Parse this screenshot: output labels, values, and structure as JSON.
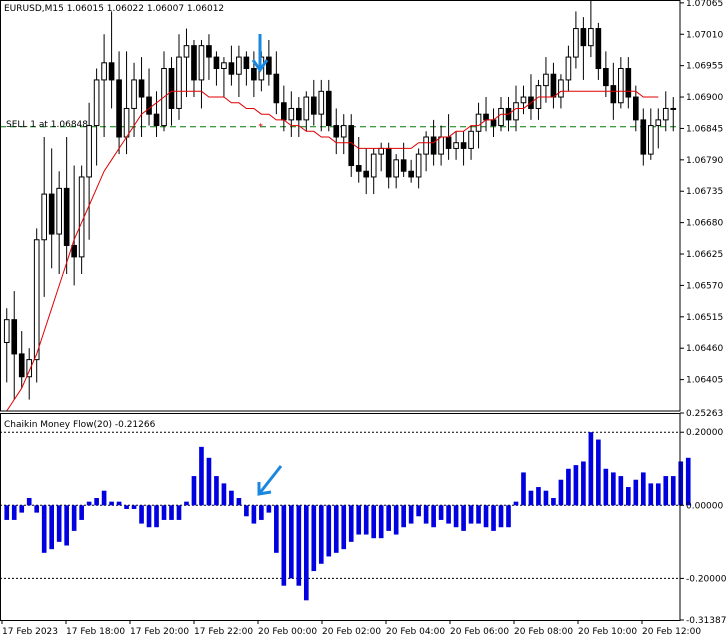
{
  "header": {
    "title": "EURUSD,M15  1.06015 1.06022 1.06007 1.06012"
  },
  "trade": {
    "line_label": "SELL 1 at 1.06848",
    "level": 1.06848,
    "color": "#007a00"
  },
  "colors": {
    "ma": "#e10000",
    "cmf": "#0000e0",
    "arrow": "#1a88e0",
    "candle": "#000000"
  },
  "chart_data": [
    {
      "type": "candlestick",
      "symbol": "EURUSD",
      "timeframe": "M15",
      "ylim": [
        1.0635,
        1.0707
      ],
      "price_ticks": [
        "1.07065",
        "1.07010",
        "1.06955",
        "1.06900",
        "1.06845",
        "1.06790",
        "1.06735",
        "1.06680",
        "1.06625",
        "1.06570",
        "1.06515",
        "1.06460",
        "1.06405"
      ],
      "x_labels": [
        "17 Feb 2023",
        "17 Feb 18:00",
        "17 Feb 20:00",
        "17 Feb 22:00",
        "20 Feb 00:00",
        "20 Feb 02:00",
        "20 Feb 04:00",
        "20 Feb 06:00",
        "20 Feb 08:00",
        "20 Feb 10:00",
        "20 Feb 12:00"
      ],
      "candles": [
        [
          1.0647,
          1.0653,
          1.064,
          1.0651
        ],
        [
          1.0651,
          1.0656,
          1.0637,
          1.0645
        ],
        [
          1.0645,
          1.0649,
          1.0639,
          1.0641
        ],
        [
          1.0641,
          1.0646,
          1.0637,
          1.0644
        ],
        [
          1.0644,
          1.0667,
          1.064,
          1.0665
        ],
        [
          1.0665,
          1.0683,
          1.0655,
          1.0673
        ],
        [
          1.0673,
          1.0681,
          1.066,
          1.0666
        ],
        [
          1.0666,
          1.0677,
          1.0659,
          1.0674
        ],
        [
          1.0674,
          1.0683,
          1.0659,
          1.0664
        ],
        [
          1.0664,
          1.0678,
          1.0657,
          1.0662
        ],
        [
          1.0662,
          1.0678,
          1.0659,
          1.0676
        ],
        [
          1.0676,
          1.0689,
          1.0665,
          1.0685
        ],
        [
          1.0685,
          1.0695,
          1.0678,
          1.0693
        ],
        [
          1.0693,
          1.0701,
          1.0683,
          1.0696
        ],
        [
          1.0696,
          1.0705,
          1.0688,
          1.0693
        ],
        [
          1.0693,
          1.0698,
          1.068,
          1.0683
        ],
        [
          1.0683,
          1.0698,
          1.068,
          1.0688
        ],
        [
          1.0688,
          1.0696,
          1.0683,
          1.0693
        ],
        [
          1.0693,
          1.0697,
          1.0683,
          1.069
        ],
        [
          1.069,
          1.0695,
          1.0685,
          1.0687
        ],
        [
          1.0687,
          1.0691,
          1.0683,
          1.0685
        ],
        [
          1.0685,
          1.0698,
          1.0684,
          1.0695
        ],
        [
          1.0695,
          1.0697,
          1.0685,
          1.0688
        ],
        [
          1.0688,
          1.0701,
          1.0686,
          1.0697
        ],
        [
          1.0697,
          1.0702,
          1.069,
          1.0699
        ],
        [
          1.0699,
          1.07,
          1.069,
          1.0693
        ],
        [
          1.0693,
          1.07,
          1.0688,
          1.0699
        ],
        [
          1.0699,
          1.0701,
          1.0693,
          1.0697
        ],
        [
          1.0697,
          1.0698,
          1.0692,
          1.0695
        ],
        [
          1.0695,
          1.0697,
          1.069,
          1.0696
        ],
        [
          1.0696,
          1.0699,
          1.0692,
          1.0694
        ],
        [
          1.0694,
          1.0699,
          1.069,
          1.0697
        ],
        [
          1.0697,
          1.0698,
          1.0692,
          1.0695
        ],
        [
          1.0695,
          1.0698,
          1.069,
          1.0693
        ],
        [
          1.0693,
          1.0698,
          1.0691,
          1.0697
        ],
        [
          1.0697,
          1.07,
          1.0692,
          1.0694
        ],
        [
          1.0694,
          1.0698,
          1.0687,
          1.0689
        ],
        [
          1.0689,
          1.0692,
          1.0684,
          1.0686
        ],
        [
          1.0686,
          1.0691,
          1.0683,
          1.0688
        ],
        [
          1.0688,
          1.069,
          1.0683,
          1.0686
        ],
        [
          1.0686,
          1.0691,
          1.0684,
          1.069
        ],
        [
          1.069,
          1.0693,
          1.0685,
          1.0687
        ],
        [
          1.0687,
          1.0693,
          1.0684,
          1.0691
        ],
        [
          1.0691,
          1.0693,
          1.0684,
          1.0685
        ],
        [
          1.0685,
          1.0688,
          1.068,
          1.0683
        ],
        [
          1.0683,
          1.0687,
          1.068,
          1.0685
        ],
        [
          1.0685,
          1.0687,
          1.0676,
          1.0678
        ],
        [
          1.0678,
          1.0683,
          1.0675,
          1.0677
        ],
        [
          1.0677,
          1.0681,
          1.0673,
          1.0676
        ],
        [
          1.0676,
          1.0681,
          1.0673,
          1.068
        ],
        [
          1.068,
          1.0682,
          1.0677,
          1.0681
        ],
        [
          1.0681,
          1.0682,
          1.0674,
          1.0676
        ],
        [
          1.0676,
          1.068,
          1.0674,
          1.0679
        ],
        [
          1.0679,
          1.0682,
          1.0676,
          1.0677
        ],
        [
          1.0677,
          1.0679,
          1.0675,
          1.0676
        ],
        [
          1.0676,
          1.0681,
          1.0674,
          1.068
        ],
        [
          1.068,
          1.0684,
          1.0677,
          1.0683
        ],
        [
          1.0683,
          1.0686,
          1.0678,
          1.068
        ],
        [
          1.068,
          1.0685,
          1.0678,
          1.0683
        ],
        [
          1.0683,
          1.0687,
          1.0679,
          1.0681
        ],
        [
          1.0681,
          1.0684,
          1.0679,
          1.0682
        ],
        [
          1.0682,
          1.0684,
          1.0678,
          1.0681
        ],
        [
          1.0681,
          1.0685,
          1.0679,
          1.0684
        ],
        [
          1.0684,
          1.0689,
          1.0681,
          1.0687
        ],
        [
          1.0687,
          1.069,
          1.0684,
          1.0686
        ],
        [
          1.0686,
          1.0688,
          1.0683,
          1.0685
        ],
        [
          1.0685,
          1.069,
          1.0684,
          1.0688
        ],
        [
          1.0688,
          1.069,
          1.0684,
          1.0686
        ],
        [
          1.0686,
          1.0692,
          1.0684,
          1.0689
        ],
        [
          1.0689,
          1.0692,
          1.0687,
          1.069
        ],
        [
          1.069,
          1.0694,
          1.0686,
          1.0688
        ],
        [
          1.0688,
          1.0693,
          1.0686,
          1.0692
        ],
        [
          1.0692,
          1.0697,
          1.0689,
          1.0694
        ],
        [
          1.0694,
          1.0696,
          1.0688,
          1.069
        ],
        [
          1.069,
          1.0694,
          1.0688,
          1.0693
        ],
        [
          1.0693,
          1.0699,
          1.0691,
          1.0697
        ],
        [
          1.0697,
          1.0705,
          1.0695,
          1.0702
        ],
        [
          1.0702,
          1.0704,
          1.0693,
          1.0699
        ],
        [
          1.0699,
          1.0707,
          1.0697,
          1.0702
        ],
        [
          1.0702,
          1.0703,
          1.0693,
          1.0695
        ],
        [
          1.0695,
          1.0698,
          1.069,
          1.0692
        ],
        [
          1.0692,
          1.0696,
          1.0686,
          1.0689
        ],
        [
          1.0689,
          1.0697,
          1.0688,
          1.0695
        ],
        [
          1.0695,
          1.0697,
          1.0688,
          1.069
        ],
        [
          1.069,
          1.0692,
          1.0684,
          1.0686
        ],
        [
          1.0686,
          1.0688,
          1.0678,
          1.068
        ],
        [
          1.068,
          1.0688,
          1.0679,
          1.0685
        ],
        [
          1.0685,
          1.0688,
          1.0681,
          1.0686
        ],
        [
          1.0686,
          1.0691,
          1.0684,
          1.0688
        ],
        [
          1.0688,
          1.069,
          1.0684,
          1.0688
        ]
      ],
      "moving_average": [
        1.0635,
        1.0637,
        1.0639,
        1.0642,
        1.0645,
        1.0649,
        1.0653,
        1.0657,
        1.0661,
        1.0665,
        1.0668,
        1.0671,
        1.0674,
        1.0677,
        1.0679,
        1.0681,
        1.0683,
        1.0685,
        1.0687,
        1.0688,
        1.0689,
        1.069,
        1.0691,
        1.0691,
        1.0691,
        1.0691,
        1.0691,
        1.069,
        1.069,
        1.069,
        1.0689,
        1.0689,
        1.0688,
        1.0688,
        1.0687,
        1.0687,
        1.0686,
        1.0686,
        1.0685,
        1.0685,
        1.0684,
        1.0684,
        1.0683,
        1.0683,
        1.0682,
        1.0682,
        1.0682,
        1.0681,
        1.0681,
        1.0681,
        1.0681,
        1.0681,
        1.0681,
        1.0681,
        1.0681,
        1.0682,
        1.0682,
        1.0682,
        1.0683,
        1.0683,
        1.0684,
        1.0684,
        1.0685,
        1.0685,
        1.0686,
        1.0686,
        1.0687,
        1.0687,
        1.0688,
        1.0688,
        1.0689,
        1.069,
        1.069,
        1.069,
        1.0691,
        1.0691,
        1.0691,
        1.0691,
        1.0691,
        1.0691,
        1.0691,
        1.0691,
        1.0691,
        1.0691,
        1.0691,
        1.069,
        1.069,
        1.069
      ],
      "entry_marker_index": 34
    },
    {
      "type": "bar",
      "title": "Chaikin Money Flow(20) -0.21266",
      "ylim": [
        -0.31387,
        0.25263
      ],
      "y_ticks": [
        "0.25263",
        "0.20000",
        "0.00000",
        "-0.20000",
        "-0.31387"
      ],
      "levels": [
        0.2,
        -0.2
      ],
      "values": [
        -0.04,
        -0.04,
        -0.02,
        0.02,
        -0.02,
        -0.13,
        -0.12,
        -0.1,
        -0.11,
        -0.07,
        -0.04,
        0.01,
        0.02,
        0.04,
        0.01,
        0.01,
        -0.01,
        -0.01,
        -0.05,
        -0.06,
        -0.06,
        -0.04,
        -0.04,
        -0.04,
        0.01,
        0.08,
        0.16,
        0.13,
        0.08,
        0.06,
        0.04,
        0.02,
        -0.03,
        -0.05,
        -0.04,
        -0.02,
        -0.13,
        -0.22,
        -0.2,
        -0.22,
        -0.26,
        -0.18,
        -0.16,
        -0.14,
        -0.13,
        -0.12,
        -0.1,
        -0.08,
        -0.08,
        -0.09,
        -0.09,
        -0.07,
        -0.08,
        -0.06,
        -0.05,
        -0.03,
        -0.05,
        -0.06,
        -0.04,
        -0.05,
        -0.06,
        -0.07,
        -0.05,
        -0.05,
        -0.06,
        -0.07,
        -0.06,
        -0.06,
        0.01,
        0.09,
        0.04,
        0.05,
        0.04,
        0.02,
        0.07,
        0.1,
        0.11,
        0.12,
        0.2,
        0.18,
        0.1,
        0.09,
        0.08,
        0.05,
        0.07,
        0.09,
        0.06,
        0.06,
        0.08,
        0.08,
        0.12,
        0.13
      ]
    }
  ]
}
